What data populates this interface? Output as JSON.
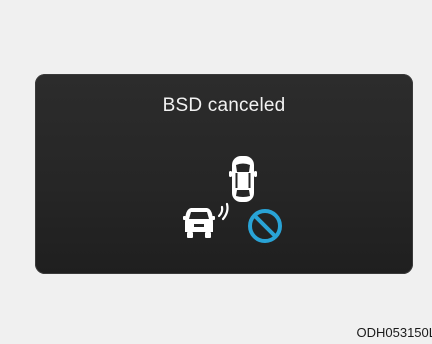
{
  "display": {
    "message": "BSD canceled",
    "icons": [
      "top-view-car-icon",
      "rear-car-icon",
      "sensor-waves-icon",
      "cancel-circle-icon"
    ],
    "colors": {
      "panel_background": "#262626",
      "text": "#f2f2f2",
      "car_icon": "#ffffff",
      "cancel_icon": "#29a3d6"
    }
  },
  "figure": {
    "code": "ODH053150L"
  }
}
